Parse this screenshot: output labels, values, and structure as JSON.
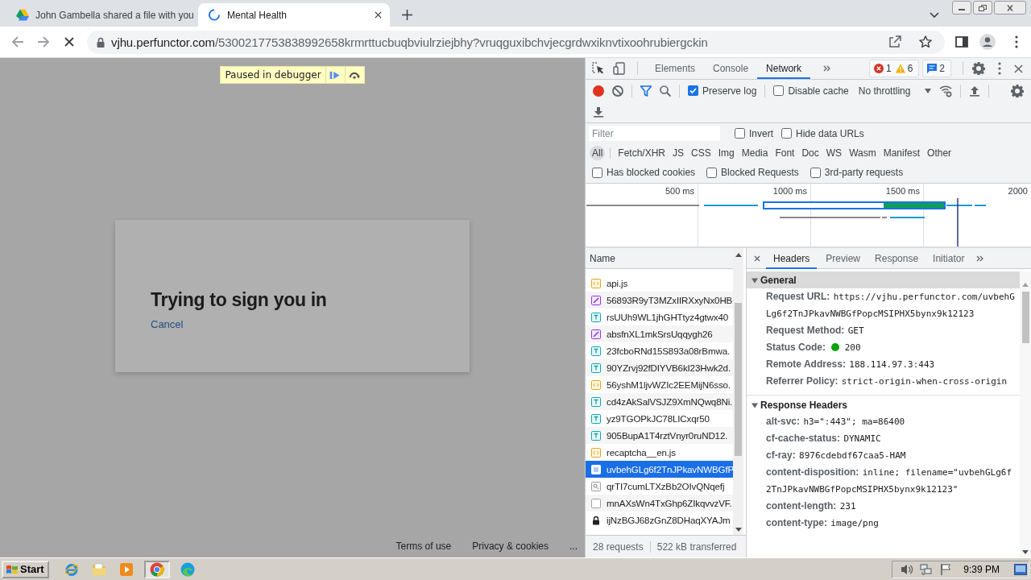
{
  "browser": {
    "tabs": [
      {
        "title": "John Gambella shared a file with you",
        "kind": "favicon",
        "selected": false
      },
      {
        "title": "Mental Health",
        "kind": "spinner",
        "selected": true
      }
    ],
    "loading": true,
    "address": {
      "host": "vjhu.perfunctor.com",
      "path": "/5300217753838992658krmrttucbuqbviulrziejbhy?vruqguxibchvjecgrdwxiknvtixoohrubiergckin"
    }
  },
  "page": {
    "debugger_banner": "Paused in debugger",
    "dialog": {
      "title": "Trying to sign you in",
      "link": "Cancel"
    },
    "footer_links": [
      "Terms of use",
      "Privacy & cookies",
      "..."
    ]
  },
  "devtools": {
    "panel_tabs": [
      {
        "label": "Elements",
        "selected": false
      },
      {
        "label": "Console",
        "selected": false
      },
      {
        "label": "Network",
        "selected": true
      }
    ],
    "issues": {
      "errors": "1",
      "warnings": "6",
      "messages": "2"
    },
    "network_toolbar": {
      "recording": true,
      "options": [
        {
          "label": "Preserve log",
          "checked": true
        },
        {
          "label": "Disable cache",
          "checked": false
        }
      ],
      "throttling": "No throttling"
    },
    "filter": {
      "placeholder": "Filter",
      "options": [
        {
          "label": "Invert",
          "checked": false
        },
        {
          "label": "Hide data URLs",
          "checked": false
        }
      ]
    },
    "type_filters": [
      {
        "label": "All",
        "selected": true
      },
      {
        "label": "Fetch/XHR",
        "selected": false
      },
      {
        "label": "JS",
        "selected": false
      },
      {
        "label": "CSS",
        "selected": false
      },
      {
        "label": "Img",
        "selected": false
      },
      {
        "label": "Media",
        "selected": false
      },
      {
        "label": "Font",
        "selected": false
      },
      {
        "label": "Doc",
        "selected": false
      },
      {
        "label": "WS",
        "selected": false
      },
      {
        "label": "Wasm",
        "selected": false
      },
      {
        "label": "Manifest",
        "selected": false
      },
      {
        "label": "Other",
        "selected": false
      }
    ],
    "more_filters": [
      {
        "label": "Has blocked cookies",
        "checked": false
      },
      {
        "label": "Blocked Requests",
        "checked": false
      },
      {
        "label": "3rd-party requests",
        "checked": false
      }
    ],
    "overview": {
      "tick_labels": [
        "500 ms",
        "1000 ms",
        "1500 ms",
        "2000"
      ]
    },
    "requests": {
      "column": "Name",
      "rows": [
        {
          "name": "api.js",
          "kind": "script",
          "selected": false
        },
        {
          "name": "56893R9yT3MZxIIRXxyNx0HB",
          "kind": "stylesheet",
          "selected": false
        },
        {
          "name": "rsUUh9WL1jhGHTtyz4gtwx40",
          "kind": "text",
          "selected": false
        },
        {
          "name": "absfnXL1mkSrsUqqygh26",
          "kind": "stylesheet",
          "selected": false
        },
        {
          "name": "23fcboRNd15S893a08rBmwa.",
          "kind": "text",
          "selected": false
        },
        {
          "name": "90YZrvj92fDIYVB6kI23Hwk2d.",
          "kind": "text",
          "selected": false
        },
        {
          "name": "56yshM1ljvWZIc2EEMijN6sso.",
          "kind": "script",
          "selected": false
        },
        {
          "name": "cd4zAkSalVSJZ9XmNQwq8Ni.",
          "kind": "text",
          "selected": false
        },
        {
          "name": "yz9TGOPkJC78LICxqr50",
          "kind": "text",
          "selected": false
        },
        {
          "name": "905BupA1T4rztVnyr0ruND12.",
          "kind": "text",
          "selected": false
        },
        {
          "name": "recaptcha__en.js",
          "kind": "script",
          "selected": false
        },
        {
          "name": "uvbehGLg6f2TnJPkavNWBGfP",
          "kind": "image",
          "selected": true
        },
        {
          "name": "qrTI7cumLTXzBb2OIvQNqefj",
          "kind": "media",
          "selected": false
        },
        {
          "name": "mnAXsWn4TxGhp6ZIkqvvzVF.",
          "kind": "blank",
          "selected": false
        },
        {
          "name": "ijNzBGJ68zGnZ8DHaqXYAJm",
          "kind": "secure",
          "selected": false
        }
      ],
      "summary": [
        "28 requests",
        "522 kB transferred"
      ]
    },
    "details": {
      "tabs": [
        {
          "label": "Headers",
          "selected": true
        },
        {
          "label": "Preview",
          "selected": false
        },
        {
          "label": "Response",
          "selected": false
        },
        {
          "label": "Initiator",
          "selected": false
        }
      ],
      "sections": [
        {
          "title": "General",
          "expanded": true,
          "highlighted": true,
          "rows": [
            {
              "name": "Request URL:",
              "value": "https://vjhu.perfunctor.com/uvbehGLg6f2TnJPkavNWBGfPopcMSIPHX5bynx9k12123",
              "kind": "text"
            },
            {
              "name": "Request Method:",
              "value": "GET",
              "kind": "text"
            },
            {
              "name": "Status Code:",
              "value": "200",
              "kind": "status"
            },
            {
              "name": "Remote Address:",
              "value": "188.114.97.3:443",
              "kind": "text"
            },
            {
              "name": "Referrer Policy:",
              "value": "strict-origin-when-cross-origin",
              "kind": "text"
            }
          ]
        },
        {
          "title": "Response Headers",
          "expanded": true,
          "highlighted": false,
          "rows": [
            {
              "name": "alt-svc:",
              "value": "h3=\":443\"; ma=86400",
              "kind": "text"
            },
            {
              "name": "cf-cache-status:",
              "value": "DYNAMIC",
              "kind": "text"
            },
            {
              "name": "cf-ray:",
              "value": "8976cdebdf67caa5-HAM",
              "kind": "text"
            },
            {
              "name": "content-disposition:",
              "value": "inline; filename=\"uvbehGLg6f2TnJPkavNWBGfPopcMSIPHX5bynx9k12123\"",
              "kind": "text"
            },
            {
              "name": "content-length:",
              "value": "231",
              "kind": "text"
            },
            {
              "name": "content-type:",
              "value": "image/png",
              "kind": "text"
            }
          ]
        }
      ]
    }
  },
  "taskbar": {
    "start_label": "Start",
    "apps": [
      {
        "kind": "ie",
        "selected": false
      },
      {
        "kind": "folder",
        "selected": false
      },
      {
        "kind": "media",
        "selected": false
      },
      {
        "kind": "chrome",
        "selected": true
      },
      {
        "kind": "edge",
        "selected": false
      }
    ],
    "clock": "9:39 PM"
  }
}
